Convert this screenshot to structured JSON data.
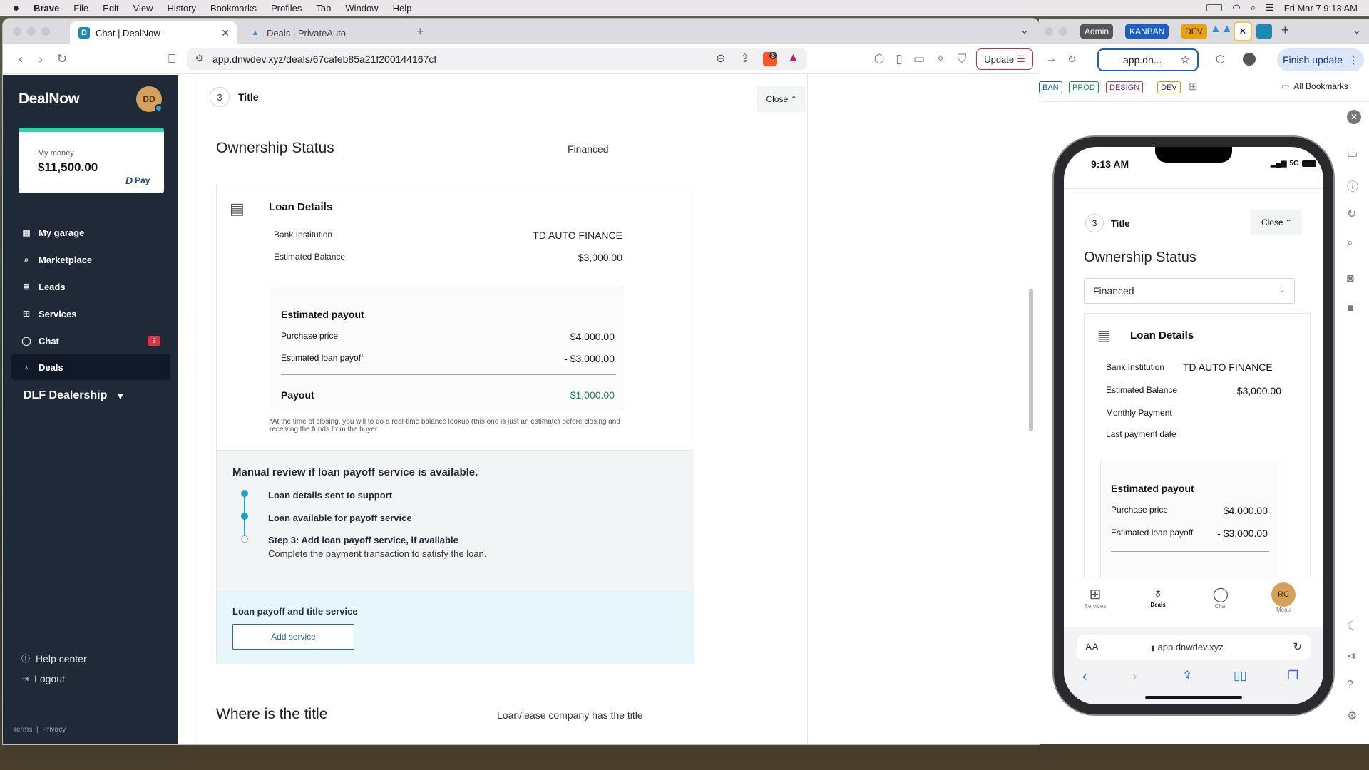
{
  "menubar": {
    "apple": "",
    "app": "Brave",
    "items": [
      "File",
      "Edit",
      "View",
      "History",
      "Bookmarks",
      "Profiles",
      "Tab",
      "Window",
      "Help"
    ],
    "clock": "Fri Mar 7  9:13 AM"
  },
  "tabs": [
    {
      "title": "Chat | DealNow",
      "active": true
    },
    {
      "title": "Deals | PrivateAuto",
      "active": false
    }
  ],
  "toolbar": {
    "url": "app.dnwdev.xyz/deals/67cafeb85a21f200144167cf",
    "shields_badge": "8",
    "update_label": "Update"
  },
  "side_browser": {
    "tabs": [
      "Admin",
      "KANBAN",
      "DEV"
    ],
    "url": "app.dn...",
    "finish_update": "Finish update",
    "bookmarks": [
      "BAN",
      "PROD",
      "DESIGN",
      "DEV"
    ],
    "all_bookmarks": "All Bookmarks"
  },
  "sidebar": {
    "logo": "DealNow",
    "avatar": "DD",
    "money_label": "My money",
    "money_value": "$11,500.00",
    "pay_label": "Pay",
    "nav": [
      {
        "label": "My garage",
        "icon": "garage-icon"
      },
      {
        "label": "Marketplace",
        "icon": "search-icon"
      },
      {
        "label": "Leads",
        "icon": "list-icon"
      },
      {
        "label": "Services",
        "icon": "grid-icon"
      },
      {
        "label": "Chat",
        "icon": "chat-icon",
        "badge": "3"
      },
      {
        "label": "Deals",
        "icon": "ribbon-icon",
        "active": true
      }
    ],
    "dealership": "DLF Dealership",
    "help": "Help center",
    "logout": "Logout",
    "terms": "Terms",
    "sep": "|",
    "privacy": "Privacy"
  },
  "section": {
    "step": "3",
    "title": "Title",
    "close": "Close",
    "ownership_label": "Ownership Status",
    "ownership_value": "Financed",
    "loan": {
      "title": "Loan Details",
      "bank_label": "Bank Institution",
      "bank_value": "TD AUTO FINANCE",
      "balance_label": "Estimated Balance",
      "balance_value": "$3,000.00"
    },
    "payout": {
      "title": "Estimated payout",
      "purchase_label": "Purchase price",
      "purchase_value": "$4,000.00",
      "loan_label": "Estimated loan payoff",
      "loan_value": "- $3,000.00",
      "payout_label": "Payout",
      "payout_value": "$1,000.00"
    },
    "disclaimer": "*At the time of closing, you will to do a real-time balance lookup (this one is just an estimate) before closing and receiving the funds from the buyer",
    "review": {
      "title": "Manual review if loan payoff service is available.",
      "step1": "Loan details sent to support",
      "step2": "Loan available for payoff service",
      "step3": "Step 3: Add loan payoff service, if available",
      "step3_desc": "Complete the payment transaction to satisfy the loan."
    },
    "service": {
      "title": "Loan payoff and title service",
      "button": "Add service"
    },
    "where_label": "Where is the title",
    "where_value": "Loan/lease company has the title"
  },
  "phone": {
    "time": "9:13 AM",
    "signal": "5G",
    "step": "3",
    "title": "Title",
    "close": "Close",
    "ownership_label": "Ownership Status",
    "ownership_value": "Financed",
    "loan_title": "Loan Details",
    "bank_label": "Bank Institution",
    "bank_value": "TD AUTO FINANCE",
    "balance_label": "Estimated Balance",
    "balance_value": "$3,000.00",
    "monthly_label": "Monthly Payment",
    "last_label": "Last payment date",
    "payout_title": "Estimated payout",
    "purchase_label": "Purchase price",
    "purchase_value": "$4,000.00",
    "loan_label": "Estimated loan payoff",
    "loan_value": "- $3,000.00",
    "nav": [
      "Services",
      "Deals",
      "Chat",
      "Menu"
    ],
    "avatar": "RC",
    "safari_aa": "AA",
    "safari_url": "app.dnwdev.xyz"
  }
}
